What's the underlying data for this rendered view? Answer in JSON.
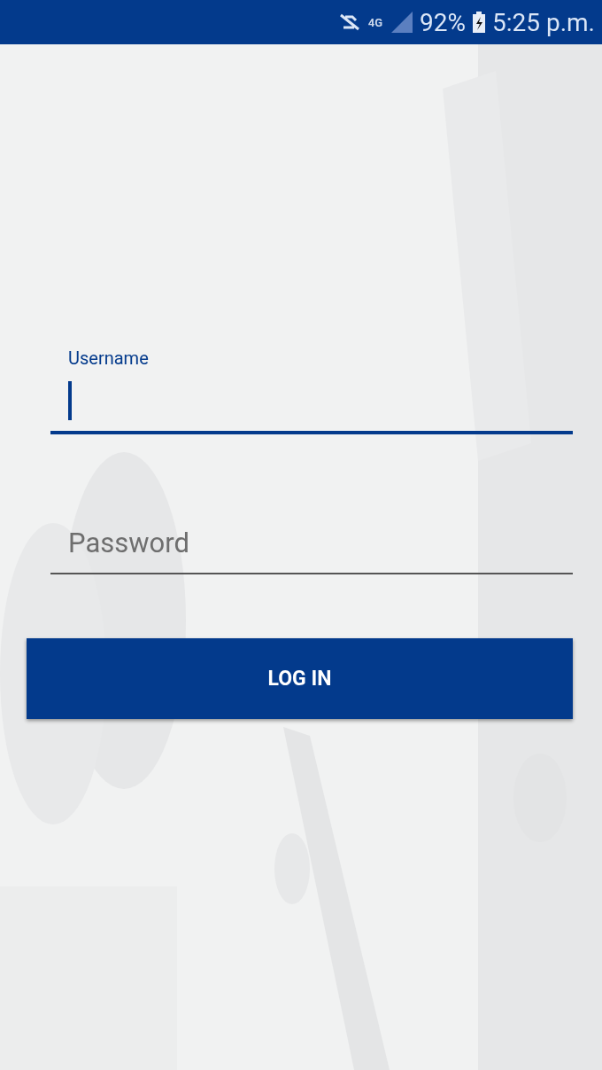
{
  "status_bar": {
    "network": "4G",
    "battery": "92%",
    "time": "5:25 p.m."
  },
  "fields": [
    {
      "label": "Username",
      "focused": true
    },
    {
      "placeholder": "Password",
      "focused": false
    }
  ],
  "button": "LOG IN"
}
